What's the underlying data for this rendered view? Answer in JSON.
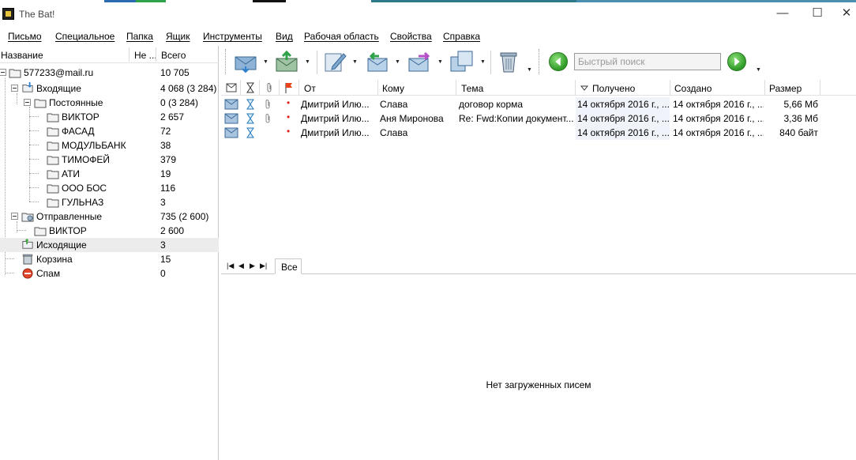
{
  "window": {
    "title": "The Bat!",
    "controls": {
      "minimize": "—",
      "maximize": "☐",
      "close": "✕"
    },
    "accent_colors": [
      "#2b6cb0",
      "#2fa24a",
      "#111111",
      "#2d7a8c"
    ]
  },
  "menu": [
    "Письмо",
    "Специальное",
    "Папка",
    "Ящик",
    "Инструменты",
    "Вид",
    "Рабочая область",
    "Свойства",
    "Справка"
  ],
  "folder_tree": {
    "columns": {
      "name": "Название",
      "unread": "Не ...",
      "total": "Всего"
    },
    "account": {
      "label": "577233@mail.ru",
      "count": "10 705"
    },
    "folders": [
      {
        "label": "Входящие",
        "count": "4 068 (3 284)",
        "icon": "inbox-icon"
      },
      {
        "label": "Постоянные",
        "count": "0 (3 284)",
        "icon": "folder-icon"
      },
      {
        "label": "ВИКТОР",
        "count": "2 657",
        "icon": "folder-icon"
      },
      {
        "label": "ФАСАД",
        "count": "72",
        "icon": "folder-icon"
      },
      {
        "label": "МОДУЛЬБАНК",
        "count": "38",
        "icon": "folder-icon"
      },
      {
        "label": "ТИМОФЕЙ",
        "count": "379",
        "icon": "folder-icon"
      },
      {
        "label": "АТИ",
        "count": "19",
        "icon": "folder-icon"
      },
      {
        "label": "ООО БОС",
        "count": "116",
        "icon": "folder-icon"
      },
      {
        "label": "ГУЛЬНАЗ",
        "count": "3",
        "icon": "folder-icon"
      },
      {
        "label": "Отправленные",
        "count": "735 (2 600)",
        "icon": "sent-folder-icon"
      },
      {
        "label": "ВИКТОР",
        "count": "2 600",
        "icon": "folder-icon"
      },
      {
        "label": "Исходящие",
        "count": "3",
        "icon": "outbox-icon"
      },
      {
        "label": "Корзина",
        "count": "15",
        "icon": "trash-icon"
      },
      {
        "label": "Спам",
        "count": "0",
        "icon": "spam-icon"
      }
    ]
  },
  "toolbar": {
    "buttons": [
      {
        "name": "get-mail",
        "icon": "get-mail-icon"
      },
      {
        "name": "send-mail",
        "icon": "send-mail-icon"
      },
      {
        "name": "new-message",
        "icon": "compose-icon"
      },
      {
        "name": "reply",
        "icon": "reply-icon"
      },
      {
        "name": "forward",
        "icon": "forward-icon"
      },
      {
        "name": "copy-to-folder",
        "icon": "copy-folder-icon"
      },
      {
        "name": "delete",
        "icon": "trash-icon"
      }
    ],
    "search_placeholder": "Быстрый поиск"
  },
  "message_list": {
    "columns": [
      "От",
      "Кому",
      "Тема",
      "Получено",
      "Создано",
      "Размер"
    ],
    "messages": [
      {
        "from": "Дмитрий Илю...",
        "to": "Слава",
        "subject": "договор корма",
        "received": "14 октября 2016 г., ...",
        "created": "14 октября 2016 г., ...",
        "size": "5,66 Мб",
        "attachment": true,
        "priority": true
      },
      {
        "from": "Дмитрий Илю...",
        "to": "Аня Миронова",
        "subject": "Re: Fwd:Копии документ...",
        "received": "14 октября 2016 г., ...",
        "created": "14 октября 2016 г., ...",
        "size": "3,36 Мб",
        "attachment": true,
        "priority": true
      },
      {
        "from": "Дмитрий Илю...",
        "to": "Слава",
        "subject": "",
        "received": "14 октября 2016 г., ...",
        "created": "14 октября 2016 г., ...",
        "size": "840 байт",
        "attachment": false,
        "priority": true
      }
    ]
  },
  "tabs": {
    "all": "Все"
  },
  "preview": {
    "empty_text": "Нет загруженных писем"
  }
}
